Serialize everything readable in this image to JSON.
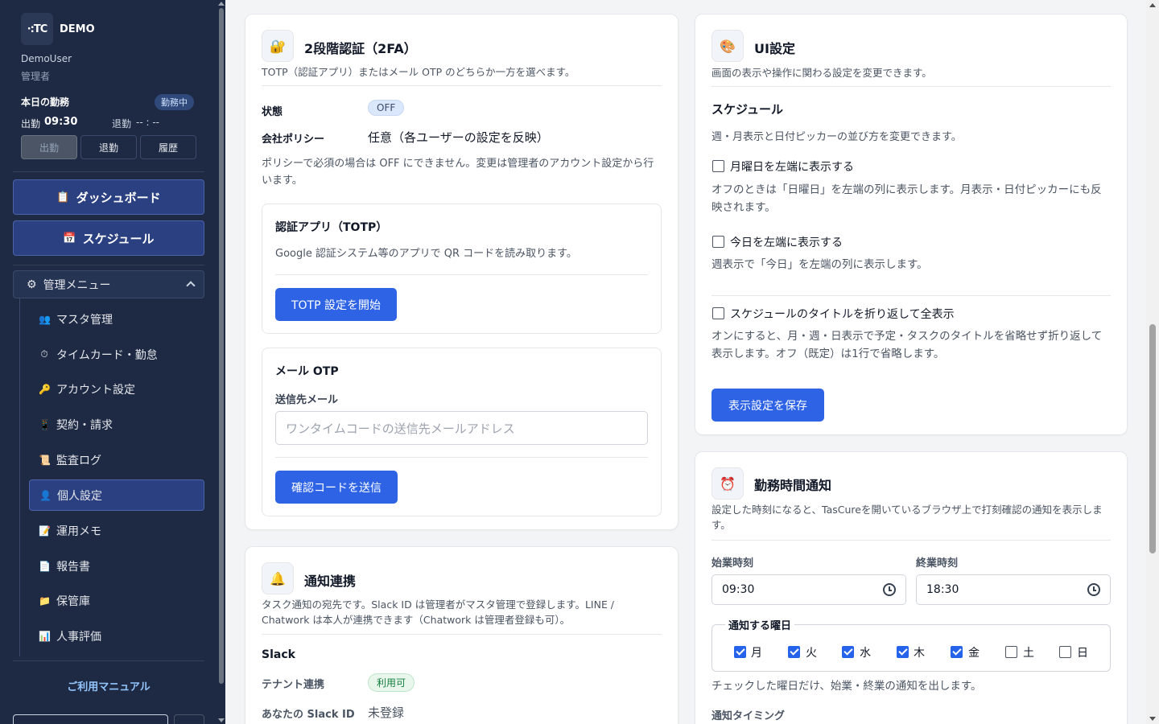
{
  "sidebar": {
    "logo_text": "·:TC",
    "brand": "DEMO",
    "user_name": "DemoUser",
    "user_role": "管理者",
    "attendance": {
      "title": "本日の勤務",
      "badge": "勤務中",
      "in_label": "出勤",
      "in_time": "09:30",
      "out_label": "退勤",
      "out_time": "-- : --",
      "btn_in": "出勤",
      "btn_out": "退勤",
      "btn_history": "履歴"
    },
    "nav_dashboard": "ダッシュボード",
    "nav_schedule": "スケジュール",
    "admin_menu": "管理メニュー",
    "items": [
      {
        "label": "マスタ管理",
        "icon": "👥"
      },
      {
        "label": "タイムカード・勤怠",
        "icon": "⏱"
      },
      {
        "label": "アカウント設定",
        "icon": "🔑"
      },
      {
        "label": "契約・請求",
        "icon": "📱"
      },
      {
        "label": "監査ログ",
        "icon": "📜"
      },
      {
        "label": "個人設定",
        "icon": "👤"
      },
      {
        "label": "運用メモ",
        "icon": "📝"
      },
      {
        "label": "報告書",
        "icon": "📄"
      },
      {
        "label": "保管庫",
        "icon": "📁"
      },
      {
        "label": "人事評価",
        "icon": "📊"
      }
    ],
    "manual": "ご利用マニュアル"
  },
  "twofa": {
    "title": "2段階認証（2FA）",
    "desc": "TOTP（認証アプリ）またはメール OTP のどちらか一方を選べます。",
    "status_label": "状態",
    "status_value": "OFF",
    "policy_label": "会社ポリシー",
    "policy_value": "任意（各ユーザーの設定を反映）",
    "policy_note": "ポリシーで必須の場合は OFF にできません。変更は管理者のアカウント設定から行います。",
    "totp_title": "認証アプリ（TOTP）",
    "totp_desc": "Google 認証システム等のアプリで QR コードを読み取ります。",
    "totp_button": "TOTP 設定を開始",
    "mail_title": "メール OTP",
    "mail_label": "送信先メール",
    "mail_placeholder": "ワンタイムコードの送信先メールアドレス",
    "mail_button": "確認コードを送信"
  },
  "notify": {
    "title": "通知連携",
    "desc": "タスク通知の宛先です。Slack ID は管理者がマスタ管理で登録します。LINE / Chatwork は本人が連携できます（Chatwork は管理者登録も可）。",
    "slack_heading": "Slack",
    "tenant_label": "テナント連携",
    "tenant_value": "利用可",
    "slack_id_label": "あなたの Slack ID",
    "slack_id_value": "未登録"
  },
  "ui": {
    "title": "UI設定",
    "desc": "画面の表示や操作に関わる設定を変更できます。",
    "schedule_heading": "スケジュール",
    "schedule_desc": "週・月表示と日付ピッカーの並び方を変更できます。",
    "opt1_label": "月曜日を左端に表示する",
    "opt1_desc": "オフのときは「日曜日」を左端の列に表示します。月表示・日付ピッカーにも反映されます。",
    "opt2_label": "今日を左端に表示する",
    "opt2_desc": "週表示で「今日」を左端の列に表示します。",
    "opt3_label": "スケジュールのタイトルを折り返して全表示",
    "opt3_desc": "オンにすると、月・週・日表示で予定・タスクのタイトルを省略せず折り返して表示します。オフ（既定）は1行で省略します。",
    "save_button": "表示設定を保存"
  },
  "worktime": {
    "title": "勤務時間通知",
    "desc": "設定した時刻になると、TasCureを開いているブラウザ上で打刻確認の通知を表示します。",
    "start_label": "始業時刻",
    "start_value": "09:30",
    "end_label": "終業時刻",
    "end_value": "18:30",
    "days_legend": "通知する曜日",
    "days": [
      {
        "label": "月",
        "checked": true
      },
      {
        "label": "火",
        "checked": true
      },
      {
        "label": "水",
        "checked": true
      },
      {
        "label": "木",
        "checked": true
      },
      {
        "label": "金",
        "checked": true
      },
      {
        "label": "土",
        "checked": false
      },
      {
        "label": "日",
        "checked": false
      }
    ],
    "days_note": "チェックした曜日だけ、始業・終業の通知を出します。",
    "timing_label": "通知タイミング"
  }
}
